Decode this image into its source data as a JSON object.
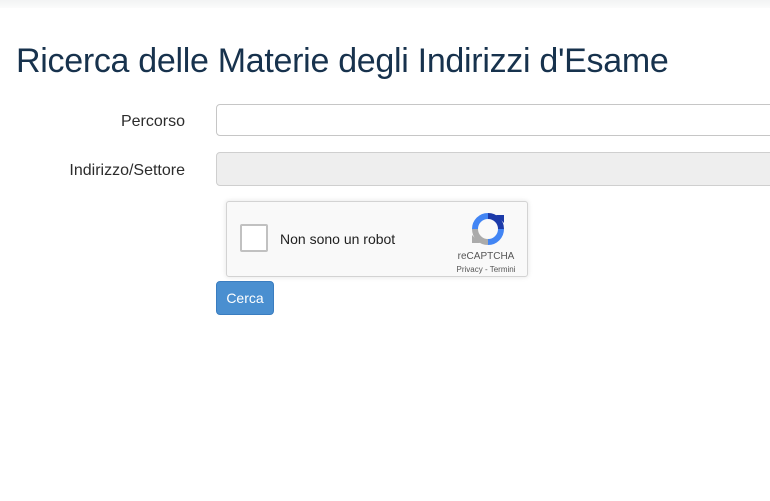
{
  "page": {
    "title": "Ricerca delle Materie degli Indirizzi d'Esame"
  },
  "form": {
    "percorso": {
      "label": "Percorso",
      "value": ""
    },
    "indirizzo": {
      "label": "Indirizzo/Settore",
      "value": ""
    },
    "submit_label": "Cerca"
  },
  "captcha": {
    "label": "Non sono un robot",
    "brand": "reCAPTCHA",
    "privacy_link": "Privacy",
    "separator": " - ",
    "terms_link": "Termini",
    "icon": "recaptcha-logo",
    "checked": false
  },
  "colors": {
    "title": "#17324d",
    "button": "#4a8fd0",
    "disabled_input": "#eeeeee"
  }
}
